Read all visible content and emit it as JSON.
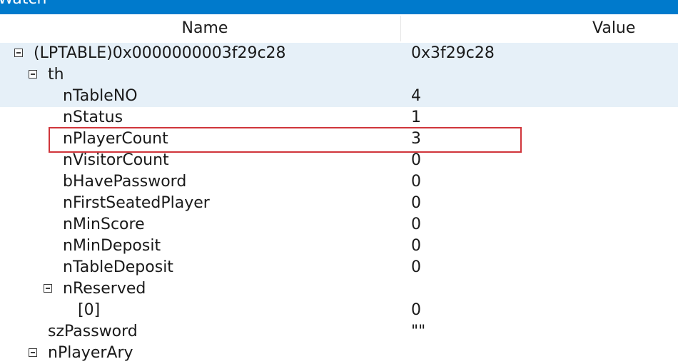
{
  "window": {
    "title": "Watch"
  },
  "columns": {
    "name": "Name",
    "value": "Value"
  },
  "rows": [
    {
      "name": "(LPTABLE)0x0000000003f29c28",
      "value": "0x3f29c28"
    },
    {
      "name": "th",
      "value": ""
    },
    {
      "name": "nTableNO",
      "value": "4"
    },
    {
      "name": "nStatus",
      "value": "1"
    },
    {
      "name": "nPlayerCount",
      "value": "3"
    },
    {
      "name": "nVisitorCount",
      "value": "0"
    },
    {
      "name": "bHavePassword",
      "value": "0"
    },
    {
      "name": "nFirstSeatedPlayer",
      "value": "0"
    },
    {
      "name": "nMinScore",
      "value": "0"
    },
    {
      "name": "nMinDeposit",
      "value": "0"
    },
    {
      "name": "nTableDeposit",
      "value": "0"
    },
    {
      "name": "nReserved",
      "value": ""
    },
    {
      "name": "[0]",
      "value": "0"
    },
    {
      "name": "szPassword",
      "value": "\"\""
    },
    {
      "name": "nPlayerAry",
      "value": ""
    }
  ],
  "icons": {
    "collapse": "collapse-toggle-icon"
  },
  "colors": {
    "titlebar": "#007acc",
    "row_highlight": "#e6f0f8",
    "selection_border": "#d0353b"
  }
}
